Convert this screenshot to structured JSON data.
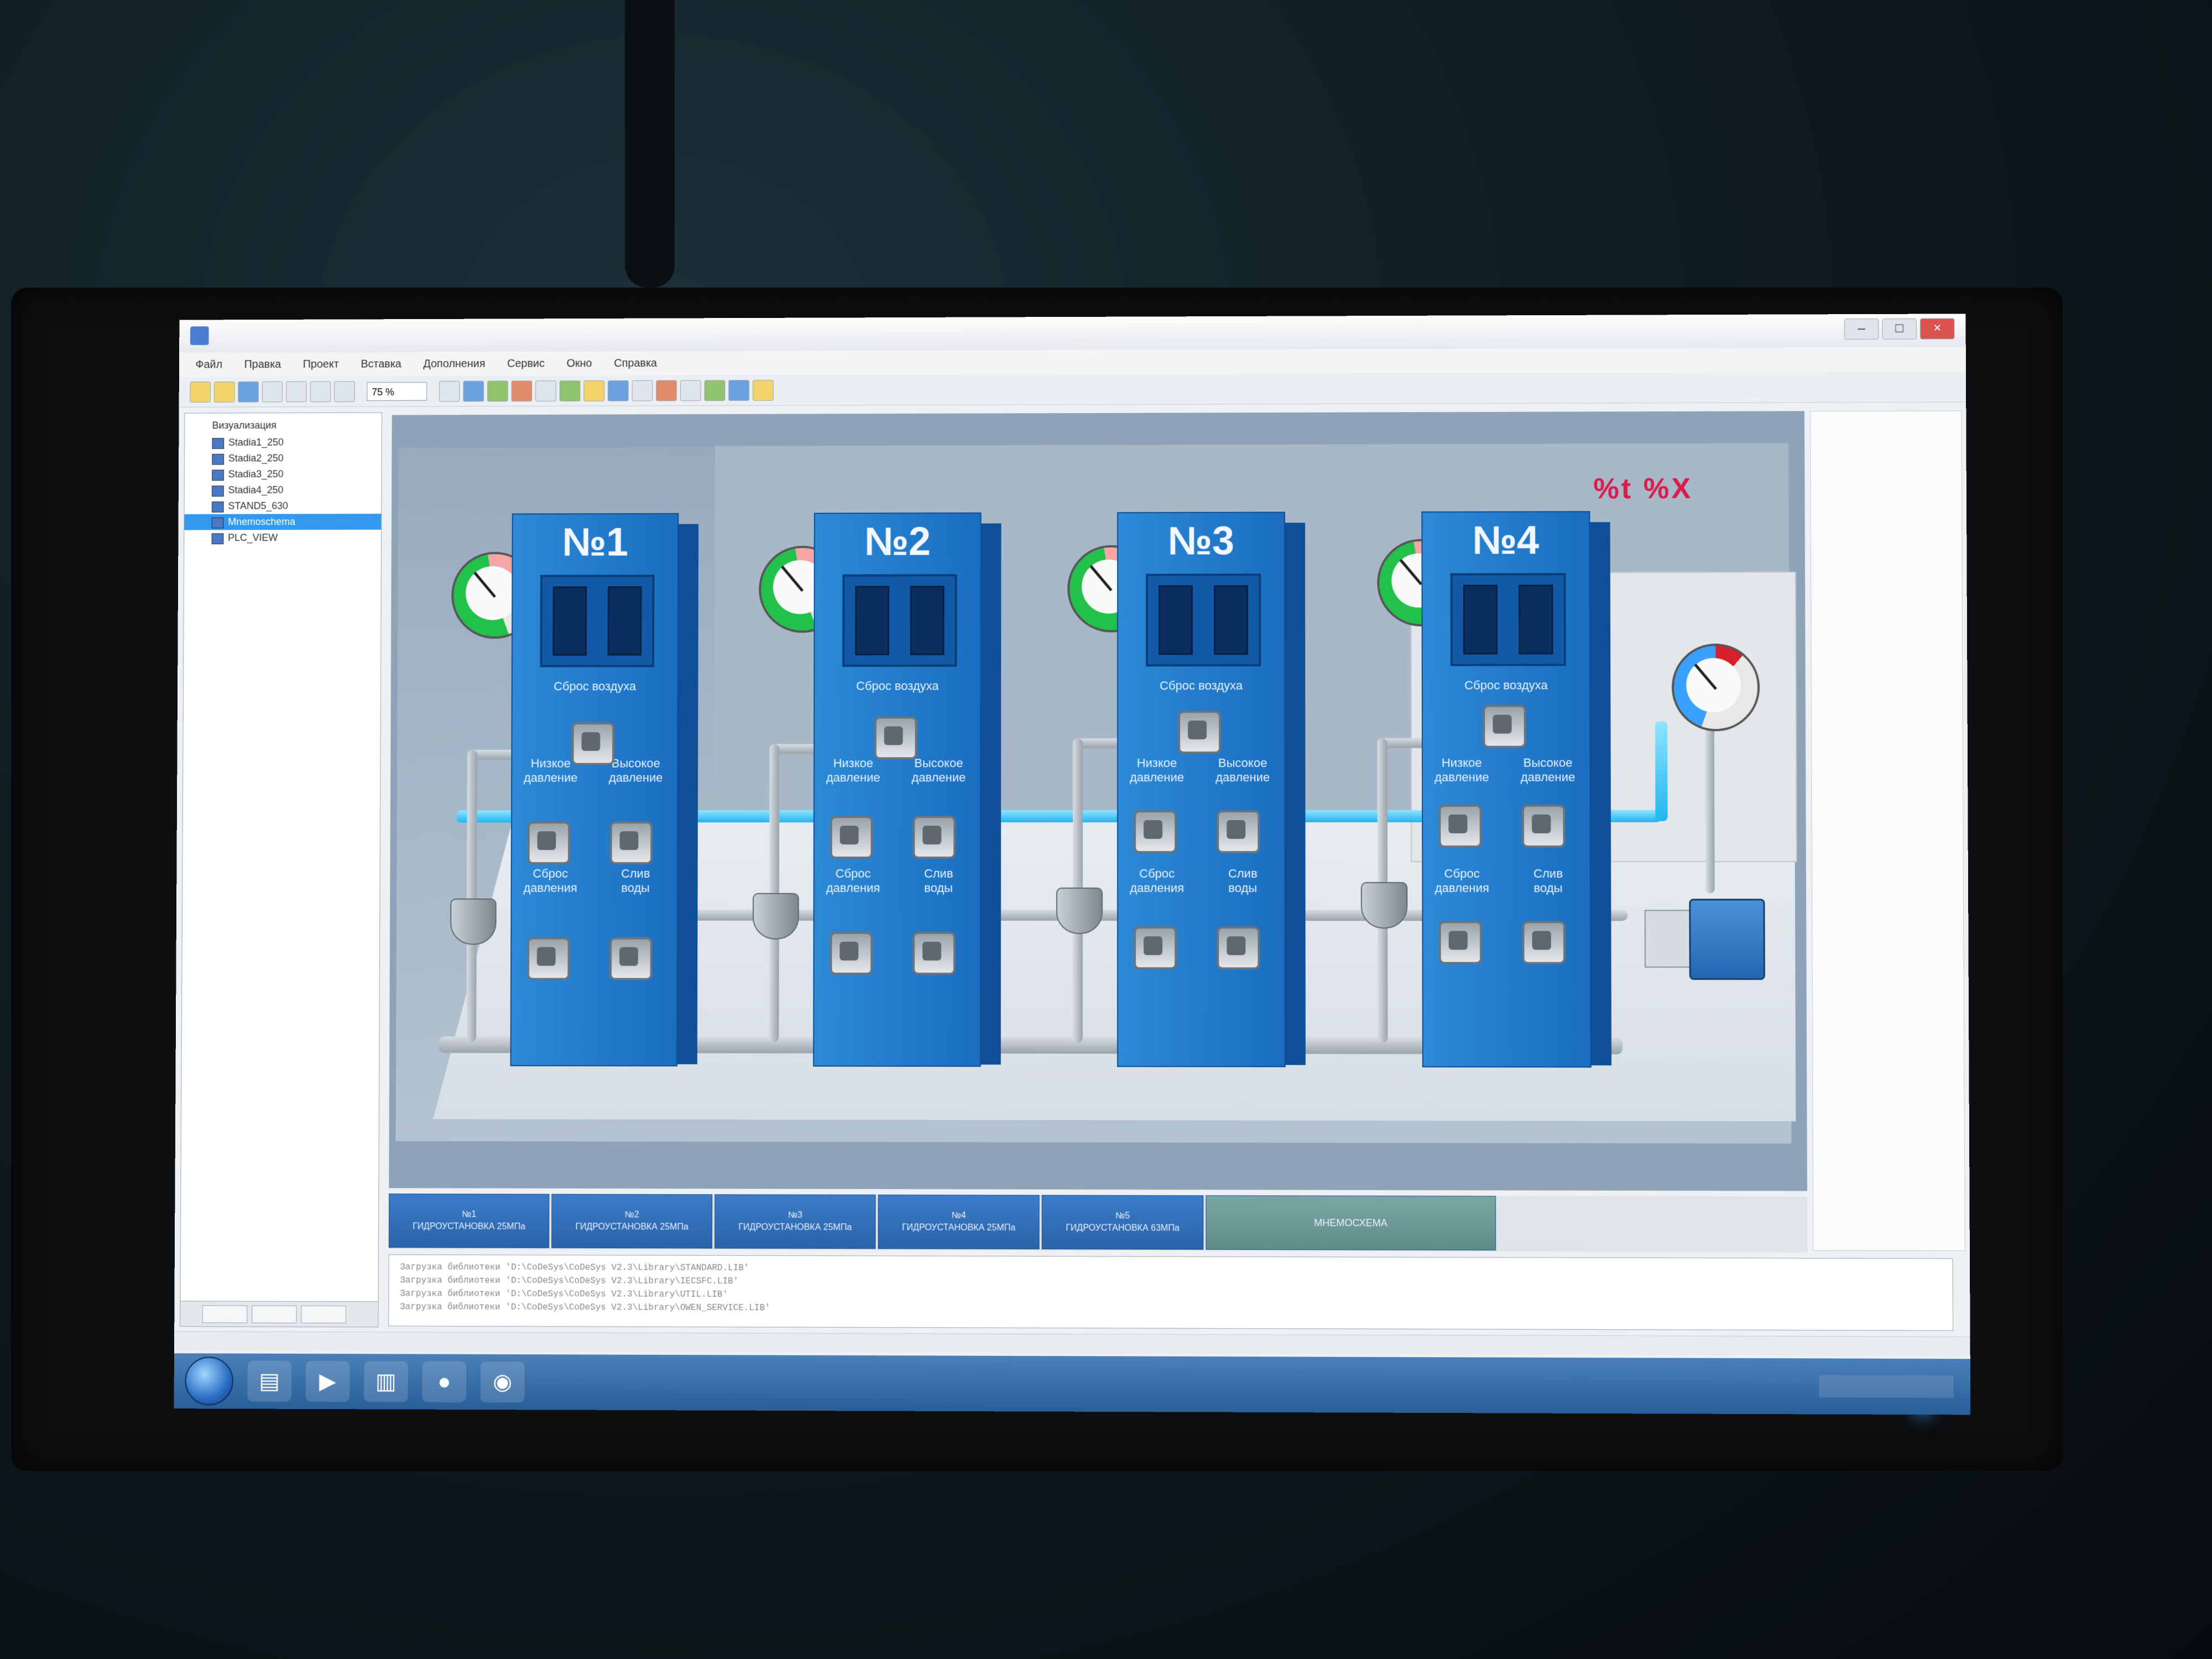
{
  "window": {
    "title": ""
  },
  "menu": [
    "Файл",
    "Правка",
    "Проект",
    "Вставка",
    "Дополнения",
    "Сервис",
    "Окно",
    "Справка"
  ],
  "toolbar": {
    "zoom": "75 %"
  },
  "tree": {
    "root": "Визуализация",
    "items": [
      "Stadia1_250",
      "Stadia2_250",
      "Stadia3_250",
      "Stadia4_250",
      "STAND5_630",
      "Mnemoschema",
      "PLC_VIEW"
    ],
    "selected_index": 5
  },
  "canvas": {
    "time_text": "%t %X",
    "stations": [
      {
        "number": "№1",
        "labels": {
          "air_release": "Сброс воздуха",
          "low_pressure": "Низкое давление",
          "high_pressure": "Высокое давление",
          "pressure_release": "Сброс давления",
          "water_drain": "Слив воды"
        }
      },
      {
        "number": "№2",
        "labels": {
          "air_release": "Сброс воздуха",
          "low_pressure": "Низкое давление",
          "high_pressure": "Высокое давление",
          "pressure_release": "Сброс давления",
          "water_drain": "Слив воды"
        }
      },
      {
        "number": "№3",
        "labels": {
          "air_release": "Сброс воздуха",
          "low_pressure": "Низкое давление",
          "high_pressure": "Высокое давление",
          "pressure_release": "Сброс давления",
          "water_drain": "Слив воды"
        }
      },
      {
        "number": "№4",
        "labels": {
          "air_release": "Сброс воздуха",
          "low_pressure": "Низкое давление",
          "high_pressure": "Высокое давление",
          "pressure_release": "Сброс давления",
          "water_drain": "Слив воды"
        }
      }
    ]
  },
  "tabs": [
    {
      "num": "№1",
      "label": "ГИДРОУСТАНОВКА 25МПа"
    },
    {
      "num": "№2",
      "label": "ГИДРОУСТАНОВКА 25МПа"
    },
    {
      "num": "№3",
      "label": "ГИДРОУСТАНОВКА 25МПа"
    },
    {
      "num": "№4",
      "label": "ГИДРОУСТАНОВКА 25МПа"
    },
    {
      "num": "№5",
      "label": "ГИДРОУСТАНОВКА 63МПа"
    }
  ],
  "mnemo_tab": "МНЕМОСХЕМА",
  "log": [
    "Загрузка библиотеки 'D:\\CoDeSys\\CoDeSys V2.3\\Library\\STANDARD.LIB'",
    "Загрузка библиотеки 'D:\\CoDeSys\\CoDeSys V2.3\\Library\\IECSFC.LIB'",
    "Загрузка библиотеки 'D:\\CoDeSys\\CoDeSys V2.3\\Library\\UTIL.LIB'",
    "Загрузка библиотеки 'D:\\CoDeSys\\CoDeSys V2.3\\Library\\OWEN_SERVICE.LIB'"
  ],
  "colors": {
    "station_blue": "#2c8ad6",
    "time_text": "#d81b4a",
    "mnemo_tab": "#6f9c99"
  }
}
